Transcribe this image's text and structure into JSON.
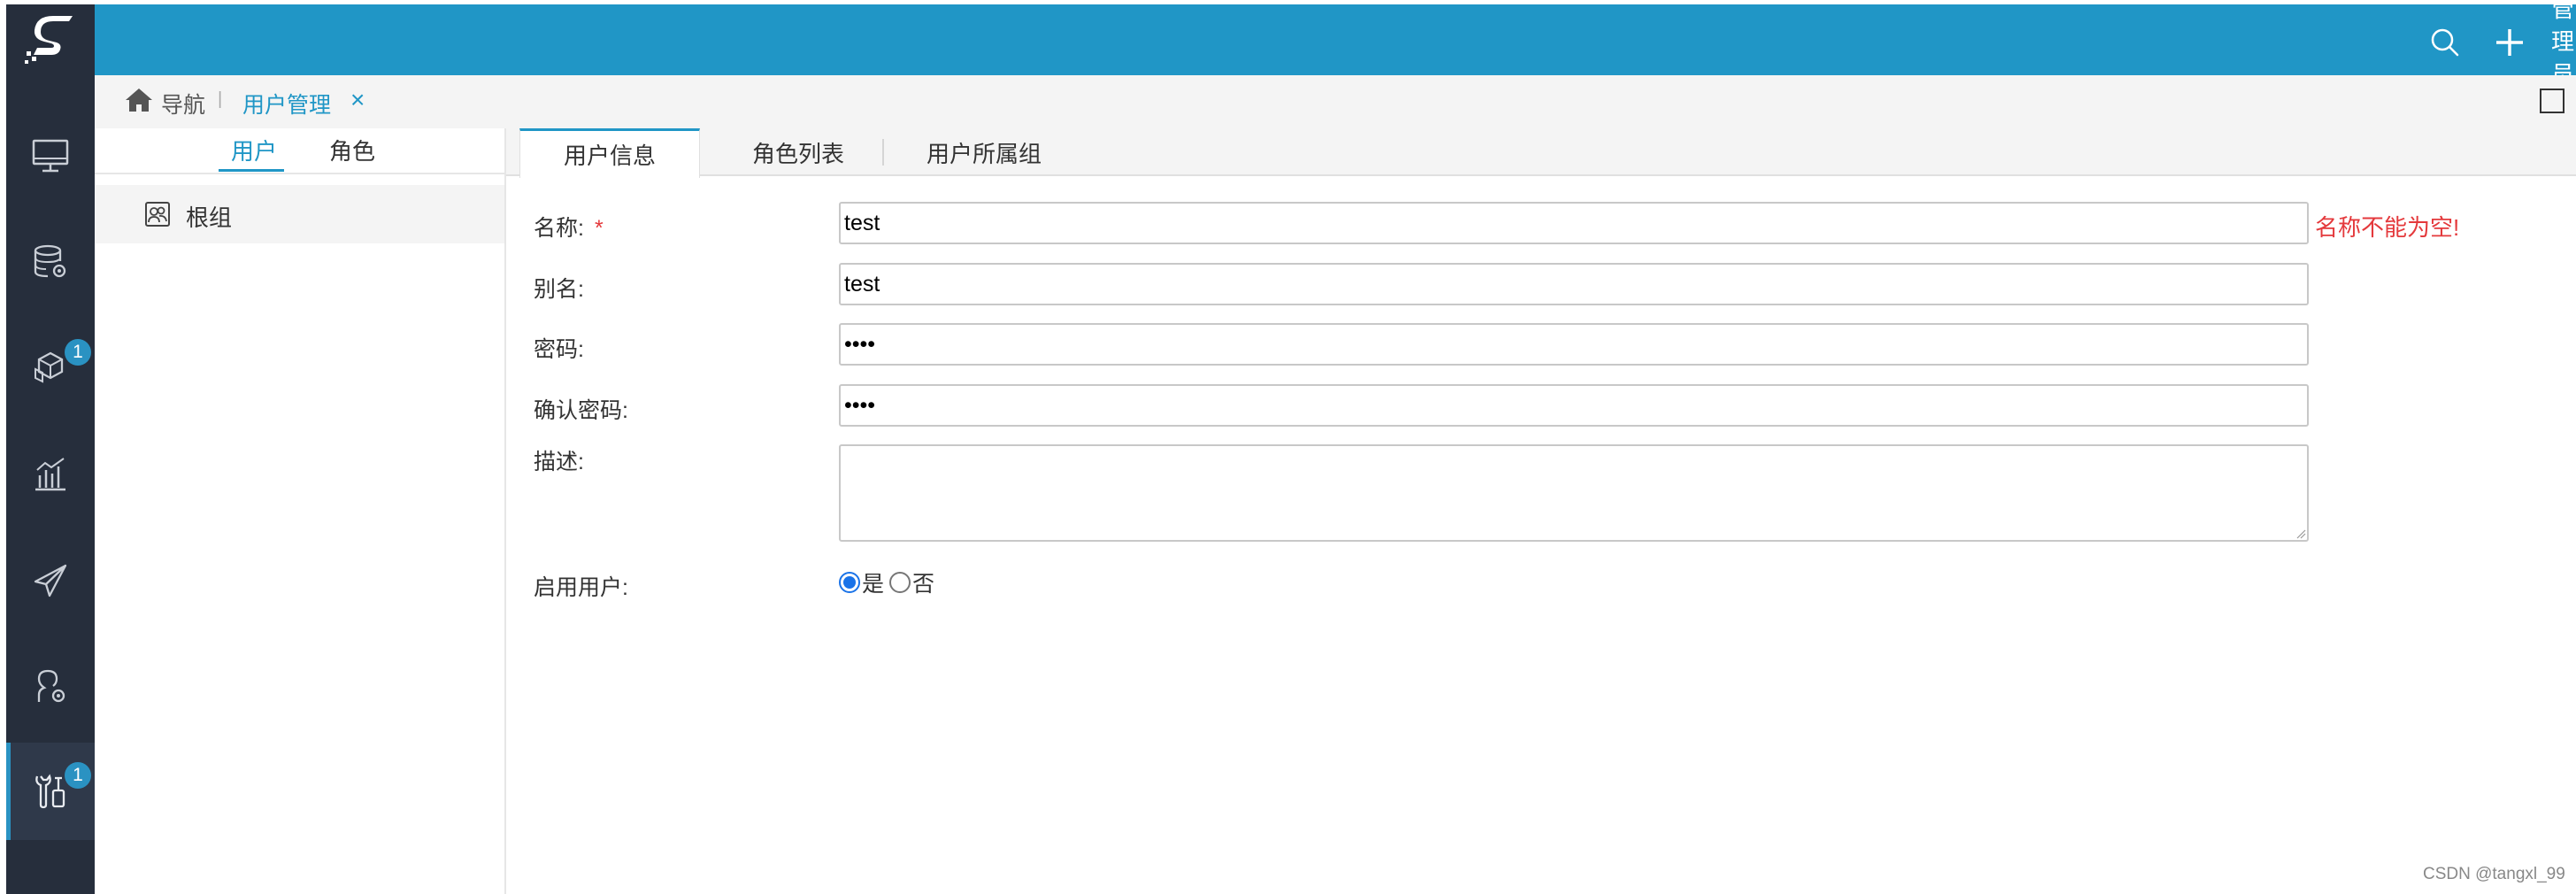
{
  "topbar": {
    "user_label": "管理员"
  },
  "sidebar": {
    "items": [
      {
        "icon": "monitor-icon",
        "badge": ""
      },
      {
        "icon": "database-settings-icon",
        "badge": ""
      },
      {
        "icon": "cubes-icon",
        "badge": "1"
      },
      {
        "icon": "bar-chart-icon",
        "badge": ""
      },
      {
        "icon": "paper-plane-icon",
        "badge": ""
      },
      {
        "icon": "user-settings-icon",
        "badge": ""
      },
      {
        "icon": "tools-icon",
        "badge": "1",
        "active": true
      }
    ]
  },
  "breadcrumb": {
    "home_label": "导航",
    "separator": "|",
    "current_label": "用户管理",
    "close_glyph": "×"
  },
  "left_panel": {
    "tabs": [
      "用户",
      "角色"
    ],
    "active_tab": "用户",
    "tree": [
      {
        "label": "根组",
        "icon": "user-group-icon"
      }
    ]
  },
  "content_tabs": {
    "tabs": [
      "用户信息",
      "角色列表",
      "用户所属组"
    ],
    "active_tab": "用户信息"
  },
  "form": {
    "name_label": "名称:",
    "required_mark": "*",
    "name_value": "test",
    "name_error": "名称不能为空!",
    "alias_label": "别名:",
    "alias_value": "test",
    "password_label": "密码:",
    "password_value": "test",
    "confirm_label": "确认密码:",
    "confirm_value": "test",
    "desc_label": "描述:",
    "desc_value": "",
    "enable_label": "启用用户:",
    "enable_yes": "是",
    "enable_no": "否",
    "enable_selected": "是"
  },
  "watermark": "CSDN @tangxl_99"
}
